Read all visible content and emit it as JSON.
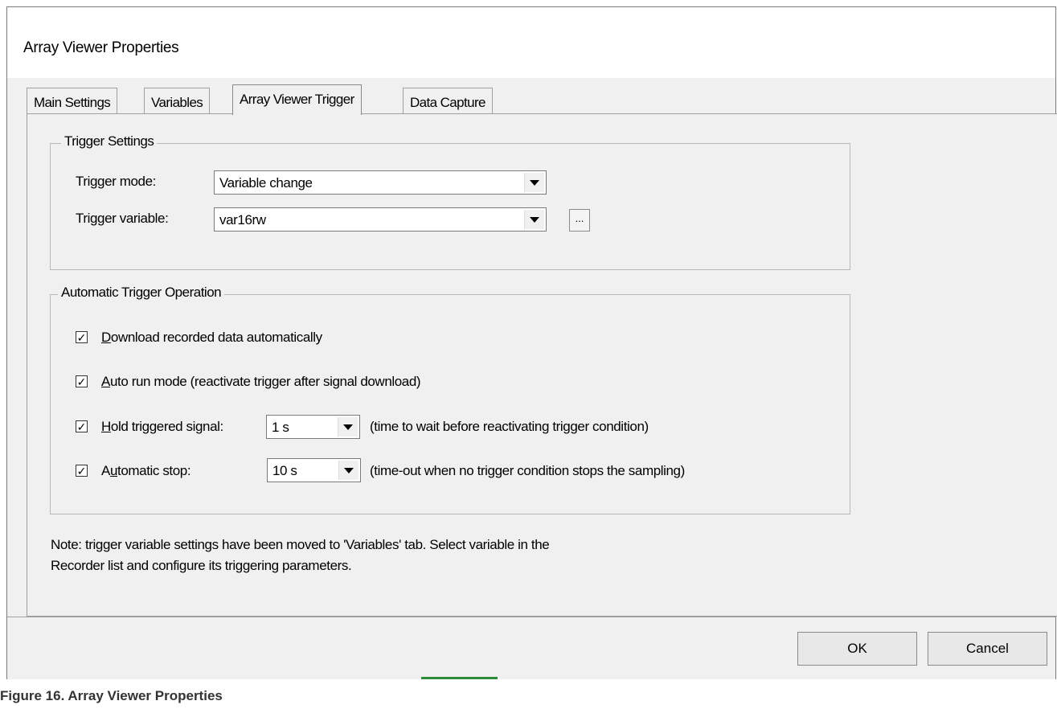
{
  "window": {
    "title": "Array Viewer Properties"
  },
  "tabs": [
    {
      "label": "Main Settings"
    },
    {
      "label": "Variables"
    },
    {
      "label": "Array Viewer Trigger"
    },
    {
      "label": "Data Capture"
    }
  ],
  "trigger_settings": {
    "group_label": "Trigger Settings",
    "mode_label": "Trigger mode:",
    "mode_value": "Variable change",
    "variable_label": "Trigger variable:",
    "variable_value": "var16rw",
    "browse_label": "..."
  },
  "auto_trigger": {
    "group_label": "Automatic Trigger Operation",
    "download": {
      "checked": true,
      "label_first": "D",
      "label_rest": "ownload recorded data automatically"
    },
    "auto_run": {
      "checked": true,
      "label_first": "A",
      "label_rest": "uto run mode (reactivate trigger after signal download)"
    },
    "hold": {
      "checked": true,
      "label_first": "H",
      "label_rest": "old triggered signal:",
      "value": "1 s",
      "hint": "(time to wait before reactivating trigger condition)"
    },
    "auto_stop": {
      "checked": true,
      "label_first": "A",
      "label_u": "u",
      "label_rest": "tomatic stop:",
      "value": "10 s",
      "hint": "(time-out when no trigger condition stops the sampling)"
    }
  },
  "note_line1": "Note: trigger variable settings have been moved to 'Variables' tab. Select variable in the",
  "note_line2": "Recorder list and configure its triggering parameters.",
  "buttons": {
    "ok": "OK",
    "cancel": "Cancel"
  },
  "caption": "Figure 16.  Array Viewer Properties",
  "colors": {
    "dialog_bg": "#f0f0f0",
    "accent_green": "#2e8b3a"
  }
}
